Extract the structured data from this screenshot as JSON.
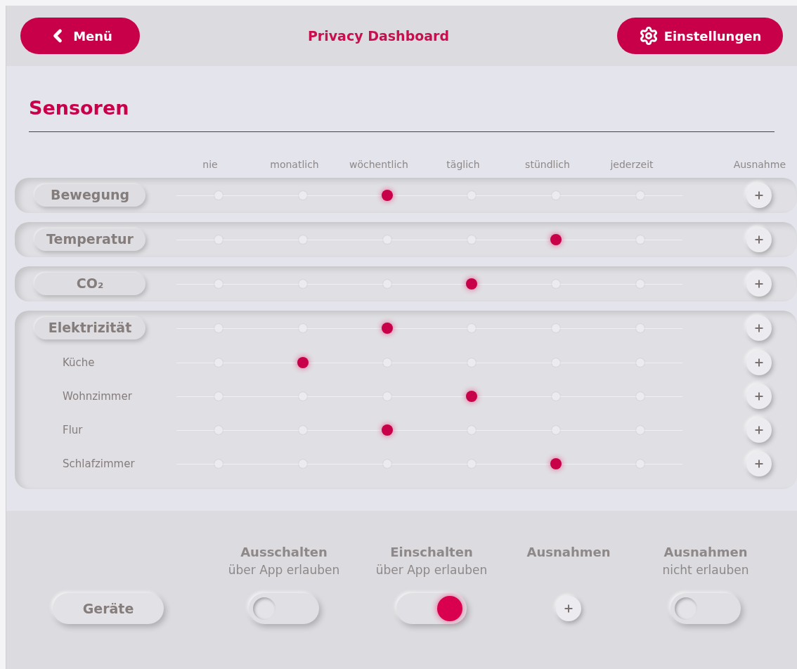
{
  "header": {
    "back_button": "Menü",
    "title": "Privacy Dashboard",
    "settings_button": "Einstellungen"
  },
  "section": {
    "title": "Sensoren"
  },
  "frequencies": [
    "nie",
    "monatlich",
    "wöchentlich",
    "täglich",
    "stündlich",
    "jederzeit"
  ],
  "exception_column": "Ausnahme",
  "sensors": [
    {
      "name": "Bewegung",
      "choices": [
        {
          "selected": false
        },
        {
          "selected": false
        },
        {
          "selected": true
        },
        {
          "selected": false
        },
        {
          "selected": false
        },
        {
          "selected": false
        }
      ]
    },
    {
      "name": "Temperatur",
      "choices": [
        {
          "selected": false
        },
        {
          "selected": false
        },
        {
          "selected": false
        },
        {
          "selected": false
        },
        {
          "selected": true
        },
        {
          "selected": false
        }
      ]
    },
    {
      "name": "CO₂",
      "choices": [
        {
          "selected": false
        },
        {
          "selected": false
        },
        {
          "selected": false
        },
        {
          "selected": true
        },
        {
          "selected": false
        },
        {
          "selected": false
        }
      ]
    },
    {
      "name": "Elektrizität",
      "choices": [
        {
          "selected": false
        },
        {
          "selected": false
        },
        {
          "selected": true
        },
        {
          "selected": false
        },
        {
          "selected": false
        },
        {
          "selected": false
        }
      ],
      "children": [
        {
          "name": "Küche",
          "choices": [
            {
              "selected": false
            },
            {
              "selected": true
            },
            {
              "selected": false
            },
            {
              "selected": false
            },
            {
              "selected": false
            },
            {
              "selected": false
            }
          ]
        },
        {
          "name": "Wohnzimmer",
          "choices": [
            {
              "selected": false
            },
            {
              "selected": false
            },
            {
              "selected": false
            },
            {
              "selected": true
            },
            {
              "selected": false
            },
            {
              "selected": false
            }
          ]
        },
        {
          "name": "Flur",
          "choices": [
            {
              "selected": false
            },
            {
              "selected": false
            },
            {
              "selected": true
            },
            {
              "selected": false
            },
            {
              "selected": false
            },
            {
              "selected": false
            }
          ]
        },
        {
          "name": "Schlafzimmer",
          "choices": [
            {
              "selected": false
            },
            {
              "selected": false
            },
            {
              "selected": false
            },
            {
              "selected": false
            },
            {
              "selected": true
            },
            {
              "selected": false
            }
          ]
        }
      ]
    }
  ],
  "devices": {
    "button": "Geräte",
    "controls": [
      {
        "title": "Ausschalten",
        "subtitle": "über App erlauben",
        "kind": "toggle",
        "on": false
      },
      {
        "title": "Einschalten",
        "subtitle": "über App erlauben",
        "kind": "toggle",
        "on": true
      },
      {
        "title": "Ausnahmen",
        "kind": "plus"
      },
      {
        "title": "Ausnahmen",
        "subtitle": "nicht erlauben",
        "kind": "toggle",
        "on": false
      }
    ]
  }
}
